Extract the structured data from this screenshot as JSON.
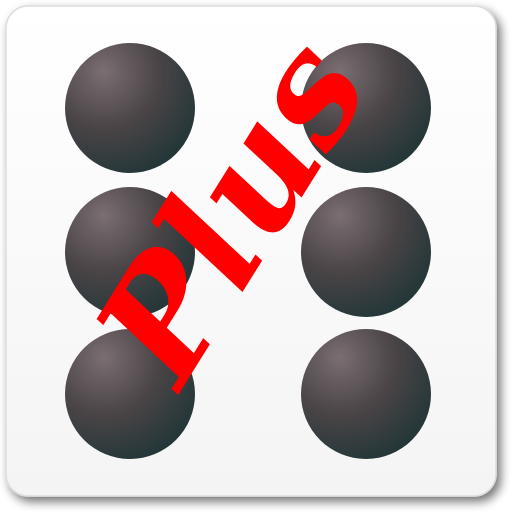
{
  "icon": {
    "name": "six-dice-plus-icon",
    "face_value": 6,
    "overlay_text": "Plus"
  },
  "colors": {
    "face": "#ffffff",
    "face_edge": "#dcdcdc",
    "shadow": "#8a8a8a",
    "pip_highlight": "#7a6e72",
    "pip_mid": "#4a4446",
    "pip_dark": "#1f3537",
    "overlay_text": "#ff0000"
  }
}
